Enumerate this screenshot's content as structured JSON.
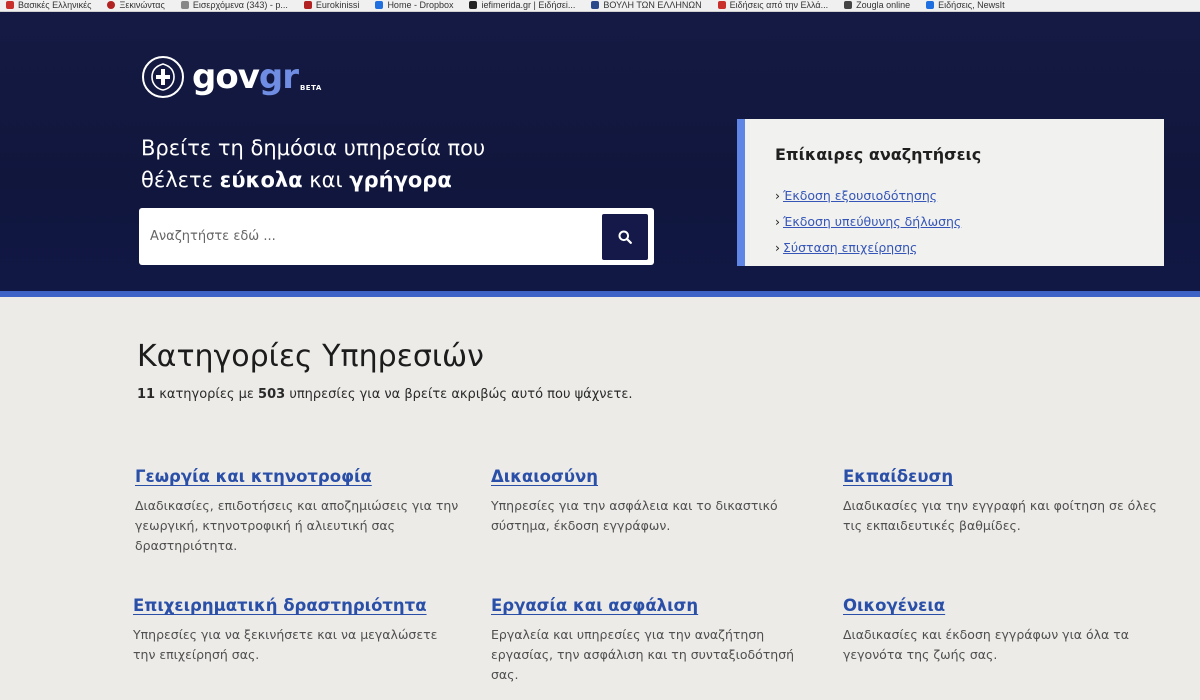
{
  "bookmarks": [
    {
      "label": "Βασικές Ελληνικές",
      "color": "#c9302c"
    },
    {
      "label": "Ξεκινώντας",
      "color": "#b22222"
    },
    {
      "label": "Εισερχόμενα (343) - p...",
      "color": "#888888"
    },
    {
      "label": "Eurokinissi",
      "color": "#b22222"
    },
    {
      "label": "Home - Dropbox",
      "color": "#1f6fe0"
    },
    {
      "label": "iefimerida.gr | Ειδήσεi...",
      "color": "#222222"
    },
    {
      "label": "ΒΟΥΛΗ ΤΩΝ ΕΛΛΗΝΩΝ",
      "color": "#2b4a8c"
    },
    {
      "label": "Ειδήσεις από την Ελλά...",
      "color": "#c9302c"
    },
    {
      "label": "Zougla online",
      "color": "#444444"
    },
    {
      "label": "Ειδήσεις, NewsIt",
      "color": "#1f6fe0"
    }
  ],
  "header": {
    "logo_main": "gov",
    "logo_accent": "gr",
    "logo_badge": "BETA",
    "tagline_line1": "Βρείτε τη δημόσια υπηρεσία που",
    "tagline_prefix": "θέλετε ",
    "tagline_bold1": "εύκολα",
    "tagline_mid": " και ",
    "tagline_bold2": "γρήγορα"
  },
  "search": {
    "placeholder": "Αναζητήστε εδώ ...",
    "button_icon": "search-icon"
  },
  "popular": {
    "title": "Επίκαιρες αναζητήσεις",
    "items": [
      {
        "label": "Έκδοση εξουσιοδότησης"
      },
      {
        "label": "Έκδοση υπεύθυνης δήλωσης"
      },
      {
        "label": "Σύσταση επιχείρησης"
      }
    ]
  },
  "main": {
    "title": "Κατηγορίες Υπηρεσιών",
    "summary_count_categories": "11",
    "summary_text1": " κατηγορίες με ",
    "summary_count_services": "503",
    "summary_text2": " υπηρεσίες για να βρείτε ακριβώς αυτό που ψάχνετε."
  },
  "categories": [
    {
      "title": "Γεωργία και κτηνοτροφία",
      "desc": "Διαδικασίες, επιδοτήσεις και αποζημιώσεις για την γεωργική, κτηνοτροφική ή αλιευτική σας δραστηριότητα."
    },
    {
      "title": "Δικαιοσύνη",
      "desc": "Υπηρεσίες για την ασφάλεια και το δικαστικό σύστημα, έκδοση εγγράφων."
    },
    {
      "title": "Εκπαίδευση",
      "desc": "Διαδικασίες για την εγγραφή και φοίτηση σε όλες τις εκπαιδευτικές βαθμίδες."
    },
    {
      "title": "Επιχειρηματική δραστηριότητα",
      "desc": "Υπηρεσίες για να ξεκινήσετε και να μεγαλώσετε την επιχείρησή σας."
    },
    {
      "title": "Εργασία και ασφάλιση",
      "desc": "Εργαλεία και υπηρεσίες για την αναζήτηση εργασίας, την ασφάλιση και τη συνταξιοδότησή σας."
    },
    {
      "title": "Οικογένεια",
      "desc": "Διαδικασίες και έκδοση εγγράφων για όλα τα γεγονότα της ζωής σας."
    }
  ],
  "colors": {
    "header_bg": "#151a44",
    "accent_blue": "#5f86e6",
    "link_blue": "#2a4fa8"
  }
}
